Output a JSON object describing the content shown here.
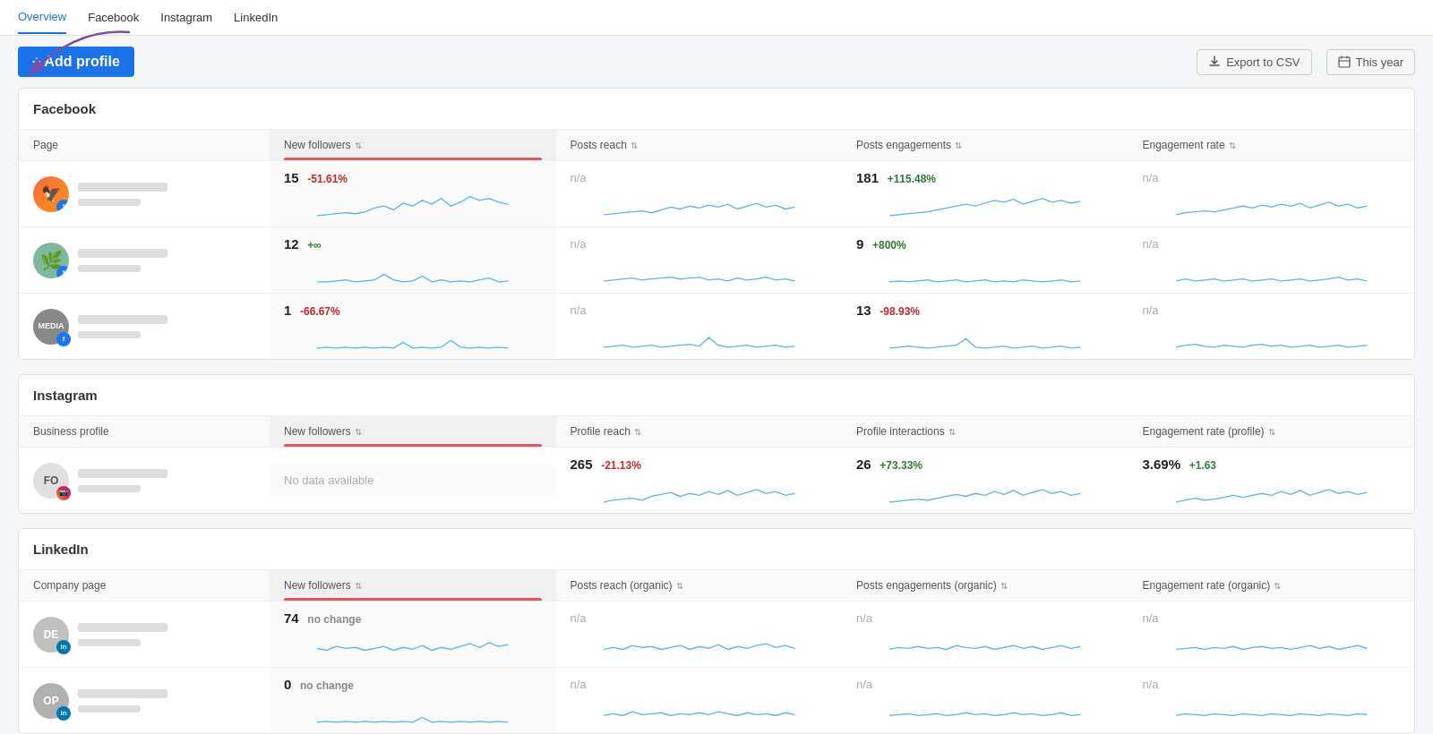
{
  "nav": {
    "items": [
      "Overview",
      "Facebook",
      "Instagram",
      "LinkedIn"
    ],
    "active": "Overview"
  },
  "toolbar": {
    "add_profile": "+ Add profile",
    "export_label": "Export to CSV",
    "date_label": "This year"
  },
  "facebook": {
    "section_title": "Facebook",
    "col_page": "Page",
    "col_new_followers": "New followers",
    "col_posts_reach": "Posts reach",
    "col_posts_engagements": "Posts engagements",
    "col_engagement_rate": "Engagement rate",
    "rows": [
      {
        "avatar_text": "",
        "avatar_type": "image1",
        "social": "facebook",
        "new_followers": "15",
        "new_followers_change": "-51.61%",
        "new_followers_trend": "negative",
        "posts_reach": "n/a",
        "posts_engagements": "181",
        "posts_engagements_change": "+115.48%",
        "posts_engagements_trend": "positive",
        "engagement_rate": "n/a"
      },
      {
        "avatar_text": "",
        "avatar_type": "image2",
        "social": "facebook",
        "new_followers": "12",
        "new_followers_change": "+∞",
        "new_followers_trend": "positive",
        "posts_reach": "n/a",
        "posts_engagements": "9",
        "posts_engagements_change": "+800%",
        "posts_engagements_trend": "positive",
        "engagement_rate": "n/a"
      },
      {
        "avatar_text": "MEDIA",
        "avatar_type": "text",
        "social": "facebook",
        "new_followers": "1",
        "new_followers_change": "-66.67%",
        "new_followers_trend": "negative",
        "posts_reach": "n/a",
        "posts_engagements": "13",
        "posts_engagements_change": "-98.93%",
        "posts_engagements_trend": "negative",
        "engagement_rate": "n/a"
      }
    ]
  },
  "instagram": {
    "section_title": "Instagram",
    "col_profile": "Business profile",
    "col_new_followers": "New followers",
    "col_profile_reach": "Profile reach",
    "col_profile_interactions": "Profile interactions",
    "col_engagement_rate": "Engagement rate (profile)",
    "rows": [
      {
        "avatar_text": "FO",
        "social": "instagram",
        "new_followers": "No data available",
        "new_followers_type": "nodata",
        "profile_reach": "265",
        "profile_reach_change": "-21.13%",
        "profile_reach_trend": "negative",
        "profile_interactions": "26",
        "profile_interactions_change": "+73.33%",
        "profile_interactions_trend": "positive",
        "engagement_rate": "3.69%",
        "engagement_rate_change": "+1.63",
        "engagement_rate_trend": "positive"
      }
    ]
  },
  "linkedin": {
    "section_title": "LinkedIn",
    "col_company": "Company page",
    "col_new_followers": "New followers",
    "col_posts_reach": "Posts reach (organic)",
    "col_posts_engagements": "Posts engagements (organic)",
    "col_engagement_rate": "Engagement rate (organic)",
    "rows": [
      {
        "avatar_text": "DE",
        "social": "linkedin",
        "new_followers": "74",
        "new_followers_change": "no change",
        "new_followers_trend": "neutral",
        "posts_reach": "n/a",
        "posts_engagements": "n/a",
        "engagement_rate": "n/a"
      },
      {
        "avatar_text": "OP",
        "social": "linkedin",
        "new_followers": "0",
        "new_followers_change": "no change",
        "new_followers_trend": "neutral",
        "posts_reach": "n/a",
        "posts_engagements": "n/a",
        "engagement_rate": "n/a"
      }
    ]
  }
}
